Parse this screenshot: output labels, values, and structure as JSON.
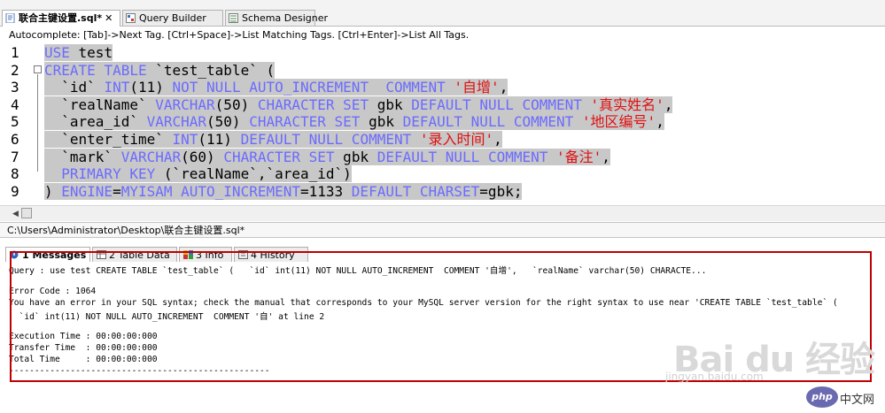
{
  "tabs": [
    {
      "label": "联合主键设置.sql*",
      "close": "✕",
      "active": true,
      "icon": "sql-file-icon"
    },
    {
      "label": "Query Builder",
      "active": false,
      "icon": "query-builder-icon"
    },
    {
      "label": "Schema Designer",
      "active": false,
      "icon": "schema-designer-icon"
    }
  ],
  "autocomplete_hint": "Autocomplete: [Tab]->Next Tag. [Ctrl+Space]->List Matching Tags. [Ctrl+Enter]->List All Tags.",
  "editor": {
    "line_numbers": [
      "1",
      "2",
      "3",
      "4",
      "5",
      "6",
      "7",
      "8",
      "9"
    ],
    "lines": [
      [
        {
          "t": "USE",
          "c": "kw"
        },
        {
          "t": " test",
          "c": "plain"
        }
      ],
      [
        {
          "t": "CREATE",
          "c": "kw"
        },
        {
          "t": " ",
          "c": "plain"
        },
        {
          "t": "TABLE",
          "c": "kw"
        },
        {
          "t": " `test_table` (",
          "c": "plain"
        }
      ],
      [
        {
          "t": "  `id` ",
          "c": "plain"
        },
        {
          "t": "INT",
          "c": "kw"
        },
        {
          "t": "(11) ",
          "c": "plain"
        },
        {
          "t": "NOT NULL AUTO_INCREMENT  COMMENT",
          "c": "kw"
        },
        {
          "t": " ",
          "c": "plain"
        },
        {
          "t": "'自增'",
          "c": "str"
        },
        {
          "t": ",",
          "c": "plain"
        }
      ],
      [
        {
          "t": "  `realName` ",
          "c": "plain"
        },
        {
          "t": "VARCHAR",
          "c": "kw"
        },
        {
          "t": "(50) ",
          "c": "plain"
        },
        {
          "t": "CHARACTER SET",
          "c": "kw"
        },
        {
          "t": " gbk ",
          "c": "plain"
        },
        {
          "t": "DEFAULT NULL COMMENT",
          "c": "kw"
        },
        {
          "t": " ",
          "c": "plain"
        },
        {
          "t": "'真实姓名'",
          "c": "str"
        },
        {
          "t": ",",
          "c": "plain"
        }
      ],
      [
        {
          "t": "  `area_id` ",
          "c": "plain"
        },
        {
          "t": "VARCHAR",
          "c": "kw"
        },
        {
          "t": "(50) ",
          "c": "plain"
        },
        {
          "t": "CHARACTER SET",
          "c": "kw"
        },
        {
          "t": " gbk ",
          "c": "plain"
        },
        {
          "t": "DEFAULT NULL COMMENT",
          "c": "kw"
        },
        {
          "t": " ",
          "c": "plain"
        },
        {
          "t": "'地区编号'",
          "c": "str"
        },
        {
          "t": ",",
          "c": "plain"
        }
      ],
      [
        {
          "t": "  `enter_time` ",
          "c": "plain"
        },
        {
          "t": "INT",
          "c": "kw"
        },
        {
          "t": "(11) ",
          "c": "plain"
        },
        {
          "t": "DEFAULT NULL COMMENT",
          "c": "kw"
        },
        {
          "t": " ",
          "c": "plain"
        },
        {
          "t": "'录入时间'",
          "c": "str"
        },
        {
          "t": ",",
          "c": "plain"
        }
      ],
      [
        {
          "t": "  `mark` ",
          "c": "plain"
        },
        {
          "t": "VARCHAR",
          "c": "kw"
        },
        {
          "t": "(60) ",
          "c": "plain"
        },
        {
          "t": "CHARACTER SET",
          "c": "kw"
        },
        {
          "t": " gbk ",
          "c": "plain"
        },
        {
          "t": "DEFAULT NULL COMMENT",
          "c": "kw"
        },
        {
          "t": " ",
          "c": "plain"
        },
        {
          "t": "'备注'",
          "c": "str"
        },
        {
          "t": ",",
          "c": "plain"
        }
      ],
      [
        {
          "t": "  ",
          "c": "plain"
        },
        {
          "t": "PRIMARY KEY",
          "c": "kw"
        },
        {
          "t": " (`realName`,`area_id`)",
          "c": "plain"
        }
      ],
      [
        {
          "t": ") ",
          "c": "plain"
        },
        {
          "t": "ENGINE",
          "c": "kw"
        },
        {
          "t": "=",
          "c": "plain"
        },
        {
          "t": "MYISAM AUTO_INCREMENT",
          "c": "kw"
        },
        {
          "t": "=1133 ",
          "c": "plain"
        },
        {
          "t": "DEFAULT CHARSET",
          "c": "kw"
        },
        {
          "t": "=gbk;",
          "c": "plain"
        }
      ]
    ]
  },
  "file_path": "C:\\Users\\Administrator\\Desktop\\联合主键设置.sql*",
  "bottom_tabs": [
    {
      "label": "1 Messages",
      "active": true,
      "icon": "messages-icon"
    },
    {
      "label": "2 Table Data",
      "active": false,
      "icon": "table-data-icon"
    },
    {
      "label": "3 Info",
      "active": false,
      "icon": "info-icon"
    },
    {
      "label": "4 History",
      "active": false,
      "icon": "history-icon"
    }
  ],
  "messages": [
    "Query : use test CREATE TABLE `test_table` (   `id` int(11) NOT NULL AUTO_INCREMENT  COMMENT '自增',   `realName` varchar(50) CHARACTE...",
    "",
    "Error Code : 1064",
    "You have an error in your SQL syntax; check the manual that corresponds to your MySQL server version for the right syntax to use near 'CREATE TABLE `test_table` (",
    "  `id` int(11) NOT NULL AUTO_INCREMENT  COMMENT '自' at line 2",
    "",
    "Execution Time : 00:00:00:000",
    "Transfer Time  : 00:00:00:000",
    "Total Time     : 00:00:00:000",
    "---------------------------------------------------"
  ],
  "watermark": {
    "brand": "Bai du 经验",
    "url": "jingyan.baidu.com",
    "php_logo": "php",
    "php_site": "中文网"
  },
  "colors": {
    "keyword": "#6b6bff",
    "string": "#e01010",
    "selection": "#c8c8c8",
    "error_box": "#c00000"
  }
}
